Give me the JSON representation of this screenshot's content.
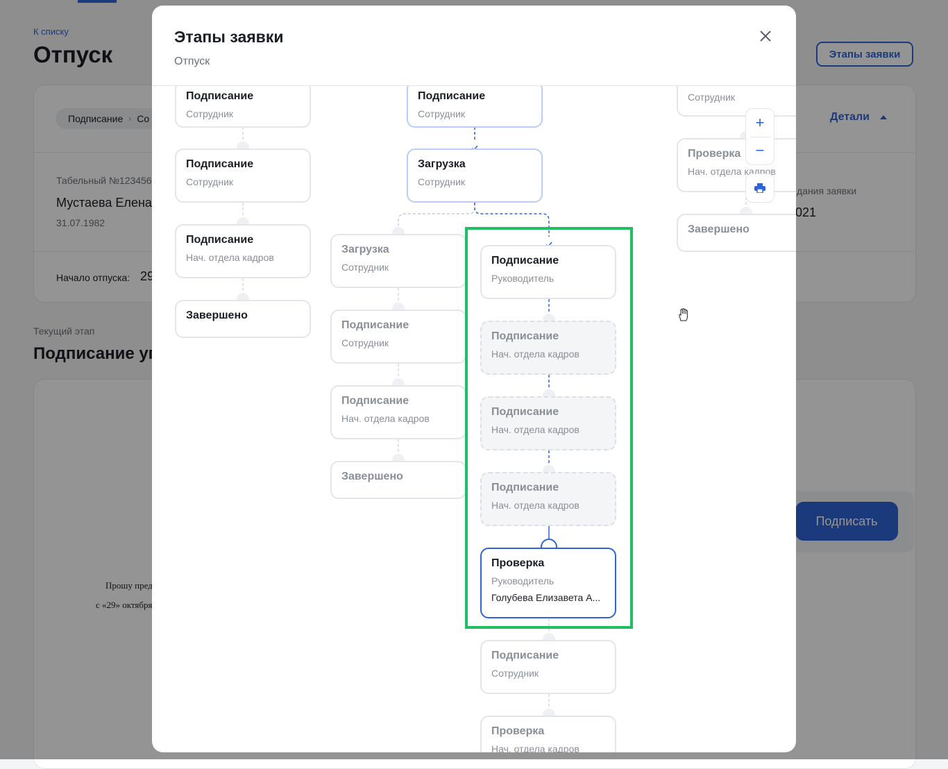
{
  "background": {
    "back_link": "К списку",
    "title": "Отпуск",
    "stages_button": "Этапы заявки",
    "breadcrumb": "Подписание",
    "breadcrumb_next": "Со",
    "details_link": "Детали",
    "tab_number": "Табельный №123456",
    "employee_name": "Мустаева Елена",
    "birth_date": "31.07.1982",
    "created_label": "дания заявки",
    "created_value": "021",
    "vacation_start_label": "Начало отпуска:",
    "vacation_start_value": "29",
    "current_stage_label": "Текущий этап",
    "current_stage_title": "Подписание уп",
    "document_line1": "Прошу предо",
    "document_line2": "с «29» октября",
    "sign_button": "Подписать"
  },
  "modal": {
    "title": "Этапы заявки",
    "subtitle": "Отпуск",
    "close_icon": "close-icon",
    "zoom_in_icon": "plus-icon",
    "zoom_out_icon": "minus-icon",
    "print_icon": "printer-icon"
  },
  "diagram": {
    "col1": [
      {
        "title": "Подписание",
        "role": "Сотрудник"
      },
      {
        "title": "Подписание",
        "role": "Сотрудник"
      },
      {
        "title": "Подписание",
        "role": "Нач. отдела кадров"
      },
      {
        "title": "Завершено"
      }
    ],
    "main": [
      {
        "title": "Подписание",
        "role": "Сотрудник",
        "state": "done"
      },
      {
        "title": "Загрузка",
        "role": "Сотрудник",
        "state": "done"
      }
    ],
    "branch_left": [
      {
        "title": "Загрузка",
        "role": "Сотрудник"
      },
      {
        "title": "Подписание",
        "role": "Сотрудник"
      },
      {
        "title": "Подписание",
        "role": "Нач. отдела кадров"
      },
      {
        "title": "Завершено"
      }
    ],
    "branch_right": [
      {
        "title": "Подписание",
        "role": "Руководитель",
        "state": "done"
      },
      {
        "title": "Подписание",
        "role": "Нач. отдела кадров",
        "state": "skipped"
      },
      {
        "title": "Подписание",
        "role": "Нач. отдела кадров",
        "state": "skipped"
      },
      {
        "title": "Подписание",
        "role": "Нач. отдела кадров",
        "state": "skipped"
      },
      {
        "title": "Проверка",
        "role": "Руководитель",
        "person": "Голубева Елизавета А...",
        "state": "active"
      },
      {
        "title": "Подписание",
        "role": "Сотрудник",
        "state": "future"
      },
      {
        "title": "Проверка",
        "role": "Нач. отдела кадров",
        "state": "future"
      }
    ],
    "col4": [
      {
        "role": "Сотрудник"
      },
      {
        "title": "Проверка",
        "role": "Нач. отдела кадров"
      },
      {
        "title": "Завершено"
      }
    ]
  },
  "colors": {
    "accent": "#2f64d6",
    "highlight": "#1fbf63",
    "node_border": "#e3e5ea",
    "done_border": "#b9cdf5"
  }
}
